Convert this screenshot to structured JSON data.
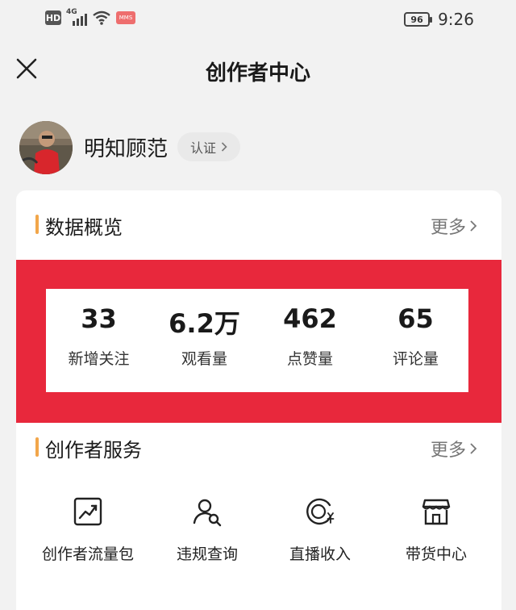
{
  "status_bar": {
    "hd": "HD",
    "network": "4G",
    "message_badge": "MMS",
    "battery": "96",
    "time": "9:26"
  },
  "nav": {
    "close_icon": "close-icon",
    "title": "创作者中心"
  },
  "profile": {
    "name": "明知顾范",
    "verify_label": "认证"
  },
  "overview": {
    "title": "数据概览",
    "more": "更多",
    "stats": [
      {
        "value": "33",
        "label": "新增关注"
      },
      {
        "value": "6.2万",
        "label": "观看量"
      },
      {
        "value": "462",
        "label": "点赞量"
      },
      {
        "value": "65",
        "label": "评论量"
      }
    ]
  },
  "services": {
    "title": "创作者服务",
    "more": "更多",
    "items": [
      {
        "label": "创作者流量包",
        "icon": "trend-chart-icon"
      },
      {
        "label": "违规查询",
        "icon": "user-search-icon"
      },
      {
        "label": "直播收入",
        "icon": "yuan-coin-icon"
      },
      {
        "label": "带货中心",
        "icon": "store-icon"
      }
    ]
  },
  "colors": {
    "accent": "#f2a64a",
    "highlight_frame": "#e8283c",
    "background": "#f2f2f2"
  }
}
